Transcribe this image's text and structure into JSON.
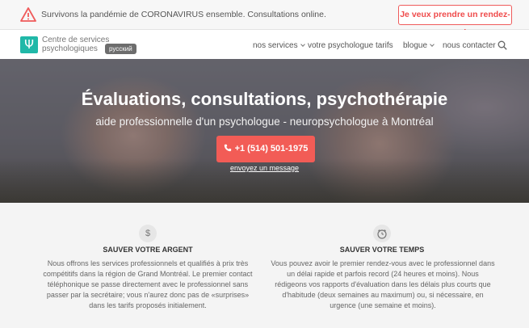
{
  "alert": {
    "message": "Survivons la pandémie de CORONAVIRUS ensemble. Consultations online.",
    "cta": "Je veux prendre un rendez-vous!"
  },
  "nav": {
    "logo_symbol": "Ψ",
    "brand_line1": "Centre de services",
    "brand_line2": "psychologiques",
    "lang": "русский",
    "items": [
      {
        "label": "nos services",
        "has_caret": true
      },
      {
        "label": "votre psychologue",
        "has_caret": false
      },
      {
        "label": "tarifs",
        "has_caret": false
      },
      {
        "label": "blogue",
        "has_caret": true
      },
      {
        "label": "nous contacter",
        "has_caret": false
      }
    ]
  },
  "hero": {
    "title": "Évaluations, consultations, psychothérapie",
    "subtitle": "aide professionnelle d'un psychologue - neuropsychologue à Montréal",
    "phone": "+1 (514) 501-1975",
    "message_link": "envoyez un message"
  },
  "features": [
    {
      "icon": "dollar-icon",
      "symbol": "$",
      "title": "SAUVER VOTRE ARGENT",
      "text": "Nous offrons les services professionnels et qualifiés à prix très compétitifs dans la région de Grand Montréal. Le premier contact téléphonique se passe directement avec le professionnel sans passer par la secrétaire; vous n'aurez donc pas de «surprises» dans les tarifs proposés initialement."
    },
    {
      "icon": "alarm-clock-icon",
      "symbol": "",
      "title": "SAUVER VOTRE TEMPS",
      "text": "Vous pouvez avoir le premier rendez-vous avec le professionnel dans un délai rapide et parfois record (24 heures et moins). Nous rédigeons vos rapports d'évaluation dans les délais plus courts que d'habitude (deux semaines au maximum) ou, si nécessaire, en urgence (une semaine et moins)."
    }
  ],
  "colors": {
    "accent_red": "#f25c56",
    "logo_teal": "#20b8a8"
  }
}
